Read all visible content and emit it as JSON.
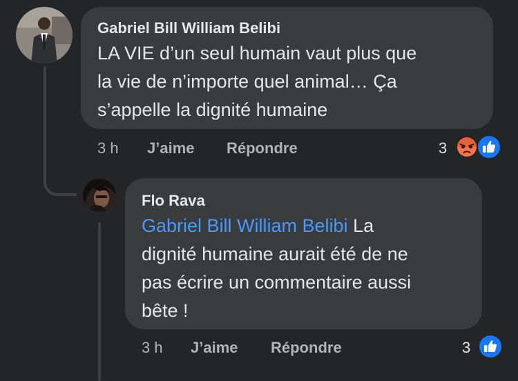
{
  "comments": [
    {
      "author": "Gabriel Bill William Belibi",
      "text_lines": [
        "LA VIE d’un seul humain vaut plus que",
        "la vie de n’importe quel animal… Ça",
        "s’appelle la dignité humaine"
      ],
      "time": "3 h",
      "like_label": "J’aime",
      "reply_label": "Répondre",
      "reaction_count": "3",
      "reactions": [
        "angry-icon",
        "like-icon"
      ]
    },
    {
      "author": "Flo Rava",
      "mention": "Gabriel Bill William Belibi",
      "text_first_after_mention": " La",
      "text_lines": [
        "dignité humaine aurait été de ne",
        "pas écrire un commentaire aussi",
        "bête !"
      ],
      "time": "3 h",
      "like_label": "J’aime",
      "reply_label": "Répondre",
      "reaction_count": "3",
      "reactions": [
        "like-icon"
      ]
    }
  ],
  "colors": {
    "background": "#242526",
    "bubble": "#3a3b3c",
    "text": "#e4e6eb",
    "secondary_text": "#b0b3b8",
    "mention": "#4599ff",
    "like_blue": "#1877f2",
    "angry_orange": "#f7714c"
  }
}
